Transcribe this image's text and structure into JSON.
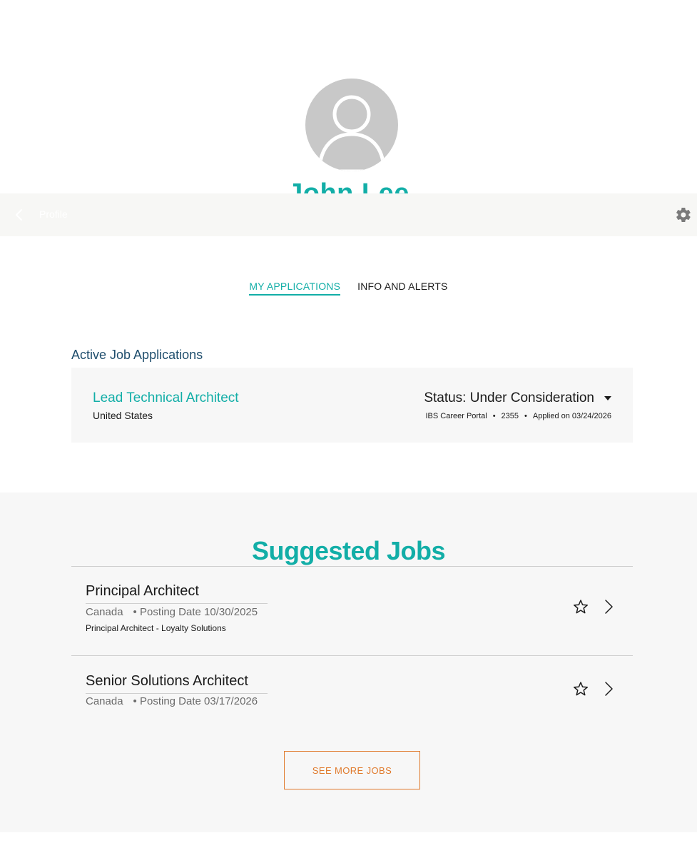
{
  "profile": {
    "name": "John Lee",
    "avatar_icon": "user-silhouette-icon"
  },
  "top_bar": {
    "back_icon": "chevron-left-icon",
    "title": "Profile",
    "settings_icon": "gear-icon"
  },
  "tabs": [
    {
      "label": "MY APPLICATIONS",
      "active": true
    },
    {
      "label": "INFO AND ALERTS",
      "active": false
    }
  ],
  "active_applications": {
    "heading": "Active Job Applications",
    "items": [
      {
        "title": "Lead Technical Architect",
        "location": "United States",
        "status": "Status: Under Consideration",
        "source": "IBS Career Portal",
        "job_id": "2355",
        "applied": "Applied on 03/24/2026",
        "separator": "•"
      }
    ]
  },
  "suggested_jobs": {
    "heading": "Suggested Jobs",
    "items": [
      {
        "title": "Principal Architect",
        "location": "Canada",
        "posting": "• Posting Date 10/30/2025",
        "description": "Principal Architect - Loyalty Solutions"
      },
      {
        "title": "Senior Solutions Architect",
        "location": "Canada",
        "posting": "• Posting Date 03/17/2026",
        "description": ""
      }
    ],
    "see_more_label": "SEE MORE JOBS"
  },
  "colors": {
    "accent": "#12aea7",
    "heading_blue": "#1f4e6d",
    "cta_orange": "#e07a2c",
    "panel_bg": "#f7f7f7"
  }
}
